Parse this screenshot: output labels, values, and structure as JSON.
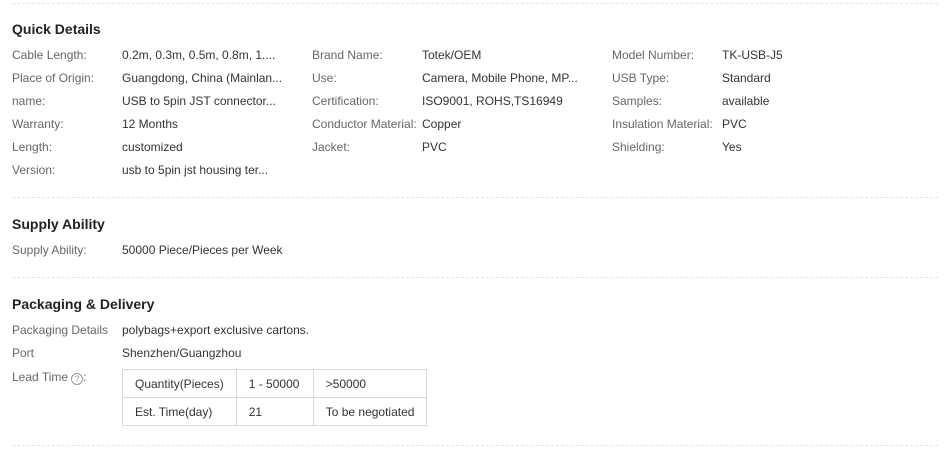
{
  "quick_details": {
    "title": "Quick Details",
    "col1": [
      {
        "label": "Cable Length:",
        "value": "0.2m, 0.3m, 0.5m, 0.8m, 1...."
      },
      {
        "label": "Place of Origin:",
        "value": "Guangdong, China (Mainlan..."
      },
      {
        "label": "name:",
        "value": "USB to 5pin JST connector..."
      },
      {
        "label": "Warranty:",
        "value": "12 Months"
      },
      {
        "label": "Length:",
        "value": "customized"
      },
      {
        "label": "Version:",
        "value": "usb to 5pin jst housing ter..."
      }
    ],
    "col2": [
      {
        "label": "Brand Name:",
        "value": "Totek/OEM"
      },
      {
        "label": "Use:",
        "value": "Camera, Mobile Phone, MP..."
      },
      {
        "label": "Certification:",
        "value": "ISO9001, ROHS,TS16949"
      },
      {
        "label": "Conductor Material:",
        "value": "Copper"
      },
      {
        "label": "Jacket:",
        "value": "PVC"
      }
    ],
    "col3": [
      {
        "label": "Model Number:",
        "value": "TK-USB-J5"
      },
      {
        "label": "USB Type:",
        "value": "Standard"
      },
      {
        "label": "Samples:",
        "value": "available"
      },
      {
        "label": "Insulation Material:",
        "value": "PVC"
      },
      {
        "label": "Shielding:",
        "value": "Yes"
      }
    ]
  },
  "supply_ability": {
    "title": "Supply Ability",
    "label": "Supply Ability:",
    "value": "50000 Piece/Pieces per Week"
  },
  "packaging_delivery": {
    "title": "Packaging & Delivery",
    "packaging_label": "Packaging Details",
    "packaging_value": "polybags+export exclusive cartons.",
    "port_label": "Port",
    "port_value": "Shenzhen/Guangzhou",
    "lead_time_label": "Lead Time",
    "help_icon": "?",
    "lead_table": {
      "header": [
        "Quantity(Pieces)",
        "1 - 50000",
        ">50000"
      ],
      "row": [
        "Est. Time(day)",
        "21",
        "To be negotiated"
      ]
    }
  }
}
